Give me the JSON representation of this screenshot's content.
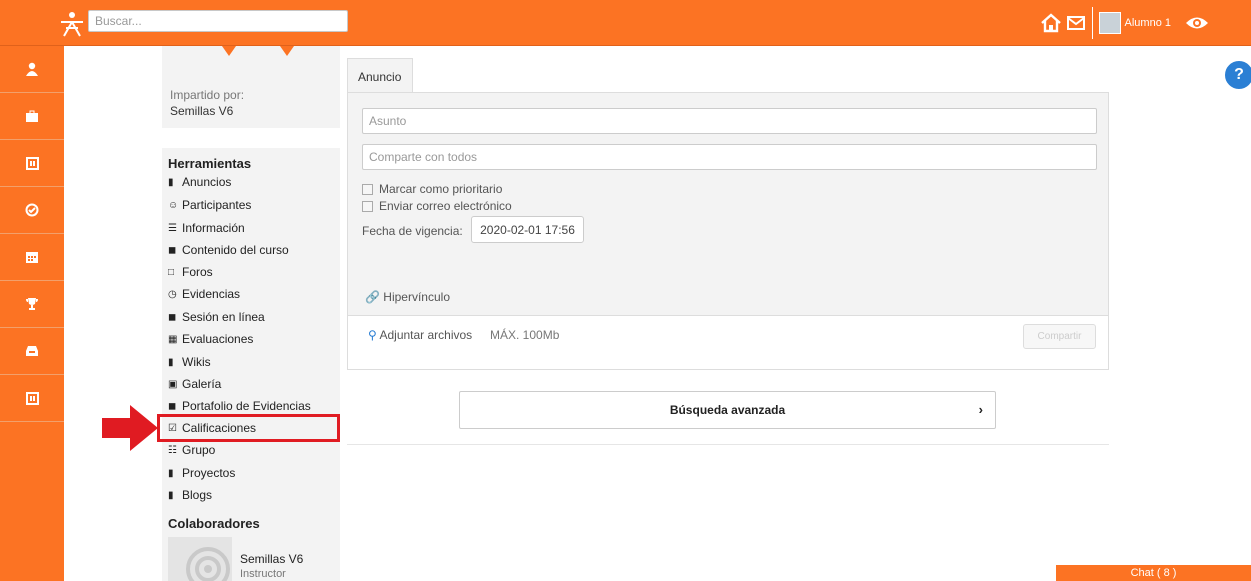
{
  "topbar": {
    "search_placeholder": "Buscar...",
    "user_name": "Alumno 1"
  },
  "course_info": {
    "label": "Impartido por:",
    "value": "Semillas V6"
  },
  "tools": {
    "heading": "Herramientas",
    "items": [
      {
        "label": "Anuncios",
        "icon": "announcement-icon"
      },
      {
        "label": "Participantes",
        "icon": "users-icon"
      },
      {
        "label": "Información",
        "icon": "list-icon"
      },
      {
        "label": "Contenido del curso",
        "icon": "content-icon"
      },
      {
        "label": "Foros",
        "icon": "forum-icon"
      },
      {
        "label": "Evidencias",
        "icon": "clock-icon"
      },
      {
        "label": "Sesión en línea",
        "icon": "video-icon"
      },
      {
        "label": "Evaluaciones",
        "icon": "evaluation-icon"
      },
      {
        "label": "Wikis",
        "icon": "bookmark-icon"
      },
      {
        "label": "Galería",
        "icon": "image-icon"
      },
      {
        "label": "Portafolio de Evidencias",
        "icon": "briefcase-icon"
      },
      {
        "label": "Calificaciones",
        "icon": "check-square-icon"
      },
      {
        "label": "Grupo",
        "icon": "group-icon"
      },
      {
        "label": "Proyectos",
        "icon": "project-icon"
      },
      {
        "label": "Blogs",
        "icon": "blog-icon"
      }
    ]
  },
  "collaborators": {
    "heading": "Colaboradores",
    "name": "Semillas V6",
    "role": "Instructor"
  },
  "announcement": {
    "tab": "Anuncio",
    "subject_placeholder": "Asunto",
    "body_placeholder": "Comparte con todos",
    "priority_label": "Marcar como prioritario",
    "email_label": "Enviar correo electrónico",
    "date_label": "Fecha de vigencia:",
    "date_value": "2020-02-01 17:56",
    "hyperlink_label": "Hipervínculo",
    "attach_label": "Adjuntar archivos",
    "attach_max": "MÁX. 100Mb",
    "share_button": "Compartir"
  },
  "advanced_search": "Búsqueda avanzada",
  "help_label": "?",
  "chat_label": "Chat ( 8 )",
  "colors": {
    "brand": "#fc7323",
    "highlight": "#e01b22",
    "help": "#2b7fd4"
  }
}
